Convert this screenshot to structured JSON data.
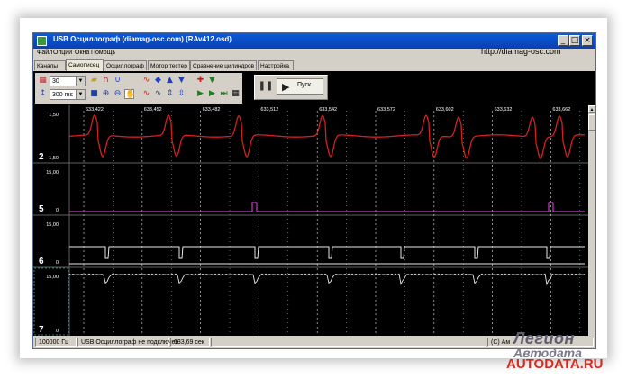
{
  "window": {
    "title": "USB Осциллограф (diamag-osc.com) (RAv412.osd)",
    "controls": {
      "minimize": "_",
      "maximize": "□",
      "close": "×"
    }
  },
  "menu": {
    "items": [
      "Файл",
      "Опции",
      "Окна",
      "Помощь"
    ]
  },
  "site_url": "http://diamag-osc.com",
  "tabs": [
    {
      "label": "Каналы",
      "active": false
    },
    {
      "label": "Самописец",
      "active": true
    },
    {
      "label": "Осциллограф",
      "active": false
    },
    {
      "label": "Мотор тестер",
      "active": false
    },
    {
      "label": "Сравнение цилиндров",
      "active": false
    },
    {
      "label": "Настройка",
      "active": false
    }
  ],
  "toolbar": {
    "scale_value": "30",
    "time_value": "300 ms",
    "start_label": "Пуск",
    "pause_icon": "pause-icon",
    "start_icon": "play-icon"
  },
  "time_ticks": [
    "633,422",
    "633,452",
    "633,482",
    "633,512",
    "633,542",
    "633,572",
    "633,602",
    "633,632",
    "633,662"
  ],
  "channels": [
    {
      "number": "2",
      "max": "1,50",
      "min": "-1,50",
      "color": "#d42020"
    },
    {
      "number": "5",
      "max": "15,00",
      "min": "0",
      "color": "#c040c0"
    },
    {
      "number": "6",
      "max": "15,00",
      "min": "0",
      "color": "#e8e8e8"
    },
    {
      "number": "7",
      "max": "15,00",
      "min": "0",
      "color": "#e8e8e8"
    }
  ],
  "status": {
    "rate": "100000 Гц",
    "connection": "USB Осциллограф не подключен",
    "time": "633,69 сек",
    "copyright": "(C) Ам"
  },
  "watermark": {
    "logo": "Легион",
    "logo2": "Автодата",
    "url": "AUTODATA.RU"
  },
  "colors": {
    "titlebar": "#0a3fb4",
    "scope_bg": "#000000",
    "grid": "#c8c8c8",
    "watermark_url": "#d62b20"
  }
}
